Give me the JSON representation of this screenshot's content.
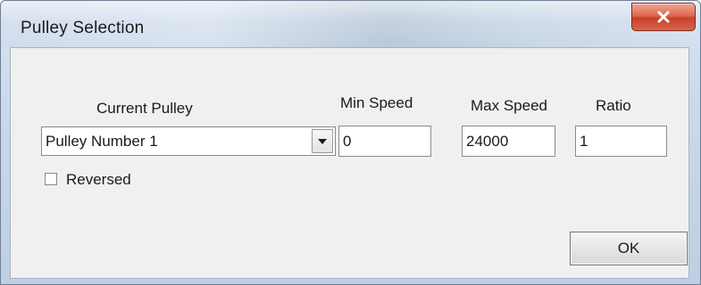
{
  "window": {
    "title": "Pulley Selection",
    "close_icon": "close-x-icon"
  },
  "current_pulley": {
    "label": "Current Pulley",
    "selected_value": "Pulley Number 1",
    "dropdown_icon": "triangle-down-icon"
  },
  "min_speed": {
    "label": "Min Speed",
    "value": "0"
  },
  "max_speed": {
    "label": "Max Speed",
    "value": "24000"
  },
  "ratio": {
    "label": "Ratio",
    "value": "1"
  },
  "reversed": {
    "label": "Reversed",
    "checked": false
  },
  "buttons": {
    "ok_label": "OK"
  },
  "colors": {
    "close_button": "#d7654b",
    "dialog_background": "#f0f0f0",
    "title_bar": "#cfdcec"
  }
}
